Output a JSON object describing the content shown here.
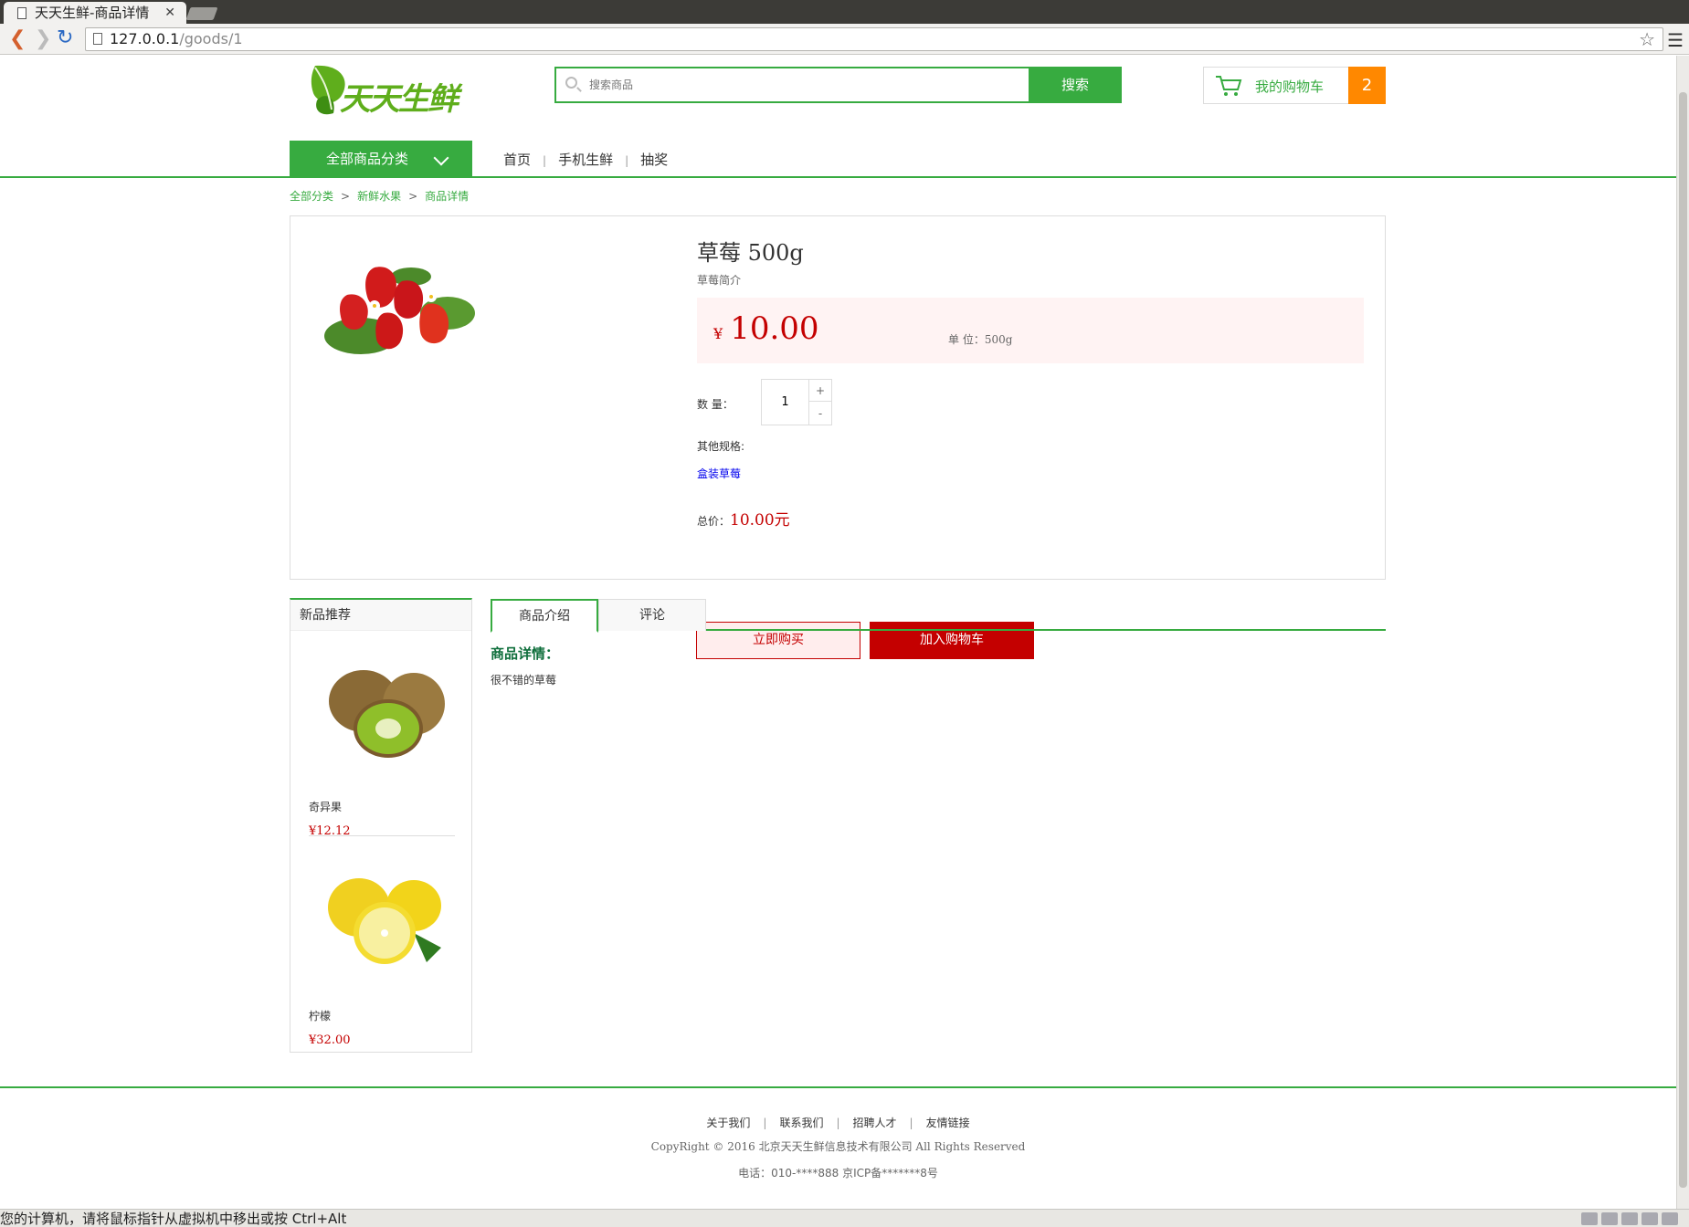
{
  "browser": {
    "tab_title": "天天生鲜-商品详情",
    "url_host": "127.0.0.1",
    "url_path": "/goods/1"
  },
  "header": {
    "logo_text": "天天生鲜",
    "search_placeholder": "搜索商品",
    "search_button": "搜索",
    "cart_label": "我的购物车",
    "cart_count": "2",
    "category_menu": "全部商品分类",
    "nav": [
      "首页",
      "手机生鲜",
      "抽奖"
    ]
  },
  "breadcrumb": [
    "全部分类",
    "新鲜水果",
    "商品详情"
  ],
  "product": {
    "title": "草莓 500g",
    "brief": "草莓简介",
    "currency": "¥",
    "price": "10.00",
    "unit": "单 位：500g",
    "qty_label": "数 量：",
    "qty_value": "1",
    "qty_plus": "+",
    "qty_minus": "-",
    "spec_label": "其他规格:",
    "spec_link": "盒装草莓",
    "total_label": "总价：",
    "total_value": "10.00元",
    "buy_now": "立即购买",
    "add_to_cart": "加入购物车"
  },
  "new_recommend": {
    "title": "新品推荐",
    "items": [
      {
        "name": "奇异果",
        "price": "¥12.12"
      },
      {
        "name": "柠檬",
        "price": "¥32.00"
      }
    ]
  },
  "tabs": [
    "商品介绍",
    "评论"
  ],
  "detail": {
    "title": "商品详情：",
    "text": "很不错的草莓"
  },
  "footer": {
    "links": [
      "关于我们",
      "联系我们",
      "招聘人才",
      "友情链接"
    ],
    "copyright": "CopyRight © 2016 北京天天生鲜信息技术有限公司 All Rights Reserved",
    "phone": "电话：010-****888 京ICP备*******8号"
  },
  "vm_status": "您的计算机，请将鼠标指针从虚拟机中移出或按 Ctrl+Alt",
  "colors": {
    "brand_green": "#37ab40",
    "price_red": "#c40000",
    "cart_orange": "#ff8800"
  }
}
